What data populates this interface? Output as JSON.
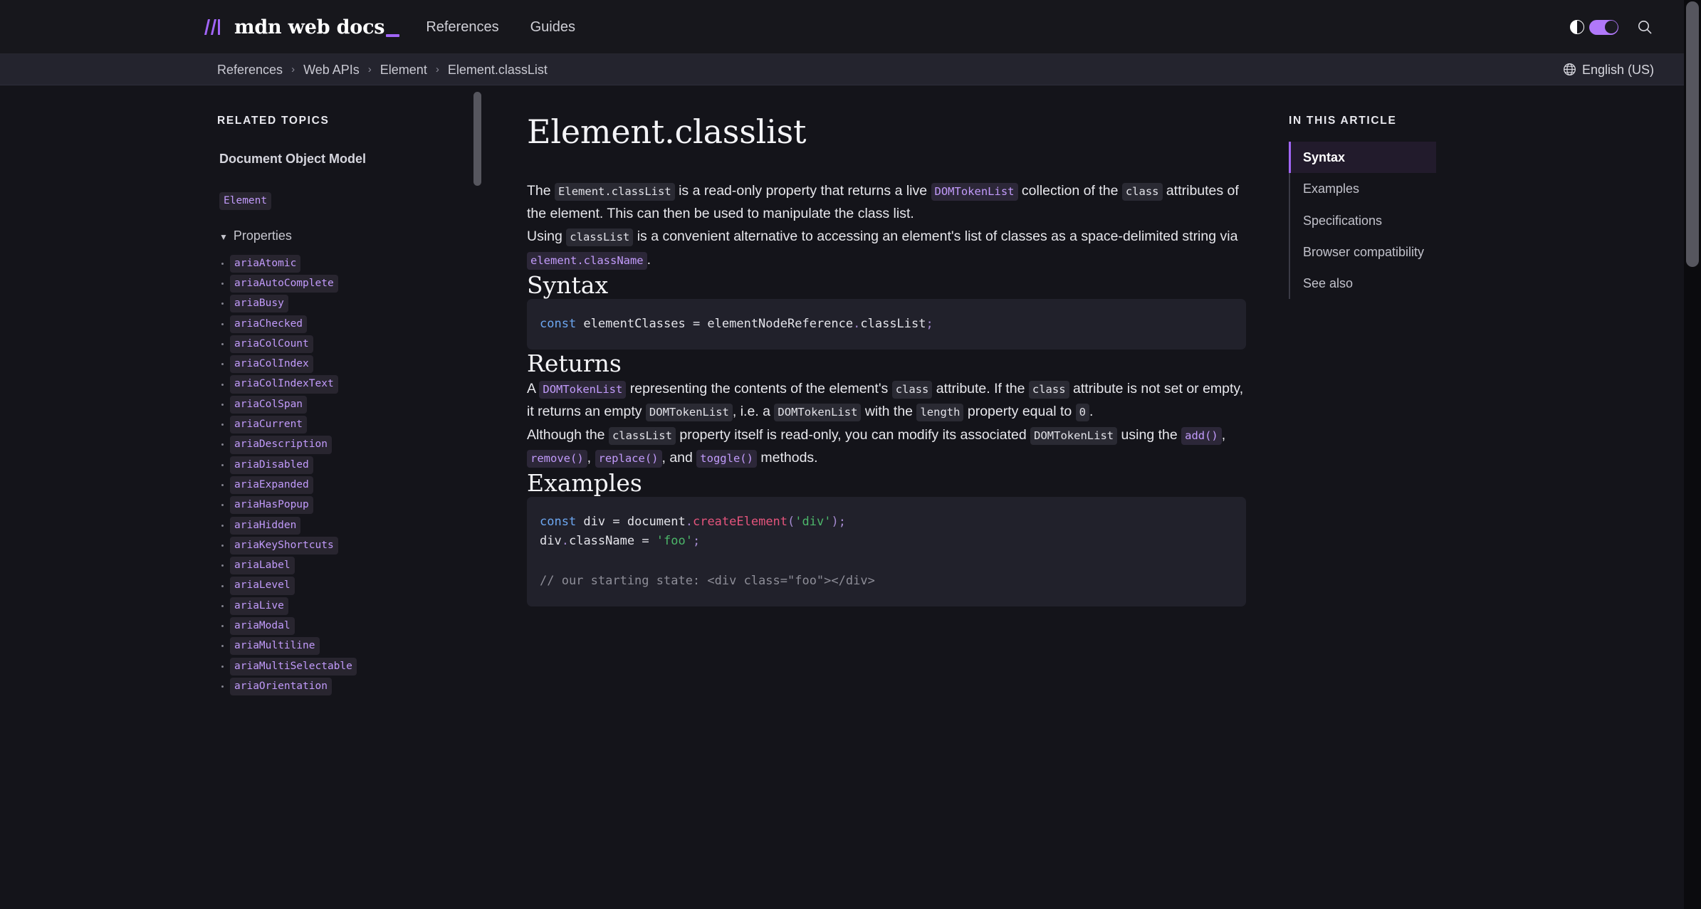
{
  "header": {
    "logo_text": "mdn web docs",
    "logo_icon": "mdn-logo-icon",
    "nav": [
      {
        "label": "References"
      },
      {
        "label": "Guides"
      }
    ],
    "theme_toggle": {
      "icon": "half-circle-contrast-icon",
      "state": "on",
      "accent_color": "#b078f9"
    },
    "search_icon": "search-icon"
  },
  "breadcrumb": {
    "items": [
      {
        "label": "References"
      },
      {
        "label": "Web APIs"
      },
      {
        "label": "Element"
      },
      {
        "label": "Element.classList"
      }
    ],
    "separator": "›"
  },
  "language_selector": {
    "icon": "globe-icon",
    "label": "English (US)"
  },
  "sidebar": {
    "heading": "RELATED TOPICS",
    "top_link": "Document Object Model",
    "element_chip": "Element",
    "group": {
      "label": "Properties",
      "expanded": true,
      "marker": "▼"
    },
    "items": [
      {
        "label": "ariaAtomic"
      },
      {
        "label": "ariaAutoComplete"
      },
      {
        "label": "ariaBusy"
      },
      {
        "label": "ariaChecked"
      },
      {
        "label": "ariaColCount"
      },
      {
        "label": "ariaColIndex"
      },
      {
        "label": "ariaColIndexText"
      },
      {
        "label": "ariaColSpan"
      },
      {
        "label": "ariaCurrent"
      },
      {
        "label": "ariaDescription"
      },
      {
        "label": "ariaDisabled"
      },
      {
        "label": "ariaExpanded"
      },
      {
        "label": "ariaHasPopup"
      },
      {
        "label": "ariaHidden"
      },
      {
        "label": "ariaKeyShortcuts"
      },
      {
        "label": "ariaLabel"
      },
      {
        "label": "ariaLevel"
      },
      {
        "label": "ariaLive"
      },
      {
        "label": "ariaModal"
      },
      {
        "label": "ariaMultiline"
      },
      {
        "label": "ariaMultiSelectable"
      },
      {
        "label": "ariaOrientation"
      }
    ]
  },
  "article": {
    "title": "Element.classlist",
    "intro_p1": {
      "t1": "The ",
      "c1": "Element.classList",
      "t2": " is a read-only property that returns a live ",
      "c2": "DOMTokenList",
      "t3": " collection of the ",
      "c3": "class",
      "t4": " attributes of the element. This can then be used to manipulate the class list."
    },
    "intro_p2": {
      "t1": "Using ",
      "c1": "classList",
      "t2": " is a convenient alternative to accessing an element's list of classes as a space-delimited string via ",
      "c2": "element.className",
      "t3": "."
    },
    "syntax": {
      "heading": "Syntax",
      "code": {
        "kw": "const",
        "mid": " elementClasses = elementNodeReference",
        "dot": ".",
        "prop": "classList",
        "semi": ";"
      }
    },
    "returns": {
      "heading": "Returns",
      "p1": {
        "t1": "A ",
        "c1": "DOMTokenList",
        "t2": " representing the contents of the element's ",
        "c2": "class",
        "t3": " attribute. If the ",
        "c3": "class",
        "t4": " attribute is not set or empty, it returns an empty ",
        "c4": "DOMTokenList",
        "t5": ", i.e. a ",
        "c5": "DOMTokenList",
        "t6": " with the ",
        "c6": "length",
        "t7": " property equal to ",
        "c7": "0",
        "t8": "."
      },
      "p2": {
        "t1": "Although the ",
        "c1": "classList",
        "t2": " property itself is read-only, you can modify its associated ",
        "c2": "DOMTokenList",
        "t3": " using the ",
        "c3": "add()",
        "t4": ", ",
        "c4": "remove()",
        "t5": ", ",
        "c5": "replace()",
        "t6": ", and ",
        "c6": "toggle()",
        "t7": " methods."
      }
    },
    "examples": {
      "heading": "Examples",
      "code": {
        "l1_kw": "const",
        "l1_a": " div = document",
        "l1_dot": ".",
        "l1_fn": "createElement",
        "l1_paren_open": "(",
        "l1_str": "'div'",
        "l1_paren_close": ")",
        "l1_semi": ";",
        "l2_a": "div",
        "l2_dot": ".",
        "l2_b": "className = ",
        "l2_str": "'foo'",
        "l2_semi": ";",
        "l4_cmt": "// our starting state: <div class=\"foo\"></div>"
      }
    }
  },
  "toc": {
    "heading": "IN THIS ARTICLE",
    "items": [
      {
        "label": "Syntax",
        "active": true
      },
      {
        "label": "Examples",
        "active": false
      },
      {
        "label": "Specifications",
        "active": false
      },
      {
        "label": "Browser compatibility",
        "active": false
      },
      {
        "label": "See also",
        "active": false
      }
    ],
    "active_accent": "#a165f7"
  }
}
